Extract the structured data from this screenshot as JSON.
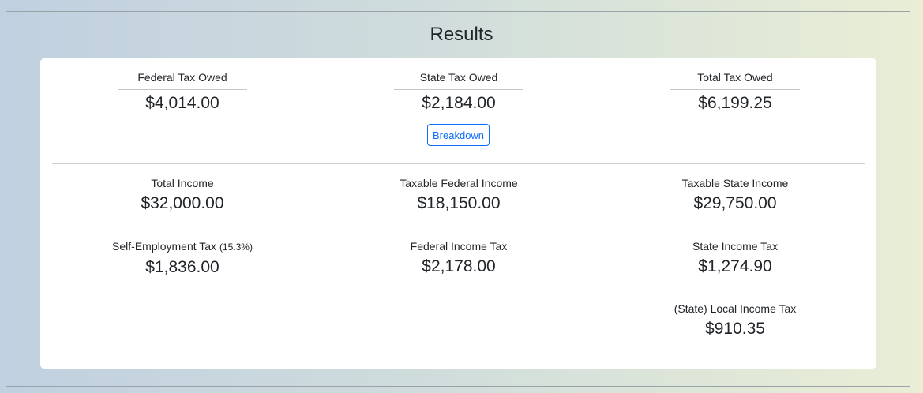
{
  "title": "Results",
  "summary": {
    "federal": {
      "label": "Federal Tax Owed",
      "value": "$4,014.00"
    },
    "state": {
      "label": "State Tax Owed",
      "value": "$2,184.00"
    },
    "total": {
      "label": "Total Tax Owed",
      "value": "$6,199.25"
    },
    "breakdown_label": "Breakdown"
  },
  "details": {
    "total_income": {
      "label": "Total Income",
      "value": "$32,000.00"
    },
    "taxable_federal_income": {
      "label": "Taxable Federal Income",
      "value": "$18,150.00"
    },
    "taxable_state_income": {
      "label": "Taxable State Income",
      "value": "$29,750.00"
    },
    "self_employment_tax": {
      "label": "Self-Employment Tax",
      "rate": "(15.3%)",
      "value": "$1,836.00"
    },
    "federal_income_tax": {
      "label": "Federal Income Tax",
      "value": "$2,178.00"
    },
    "state_income_tax": {
      "label": "State Income Tax",
      "value": "$1,274.90"
    },
    "local_income_tax": {
      "label": "(State) Local Income Tax",
      "value": "$910.35"
    }
  }
}
